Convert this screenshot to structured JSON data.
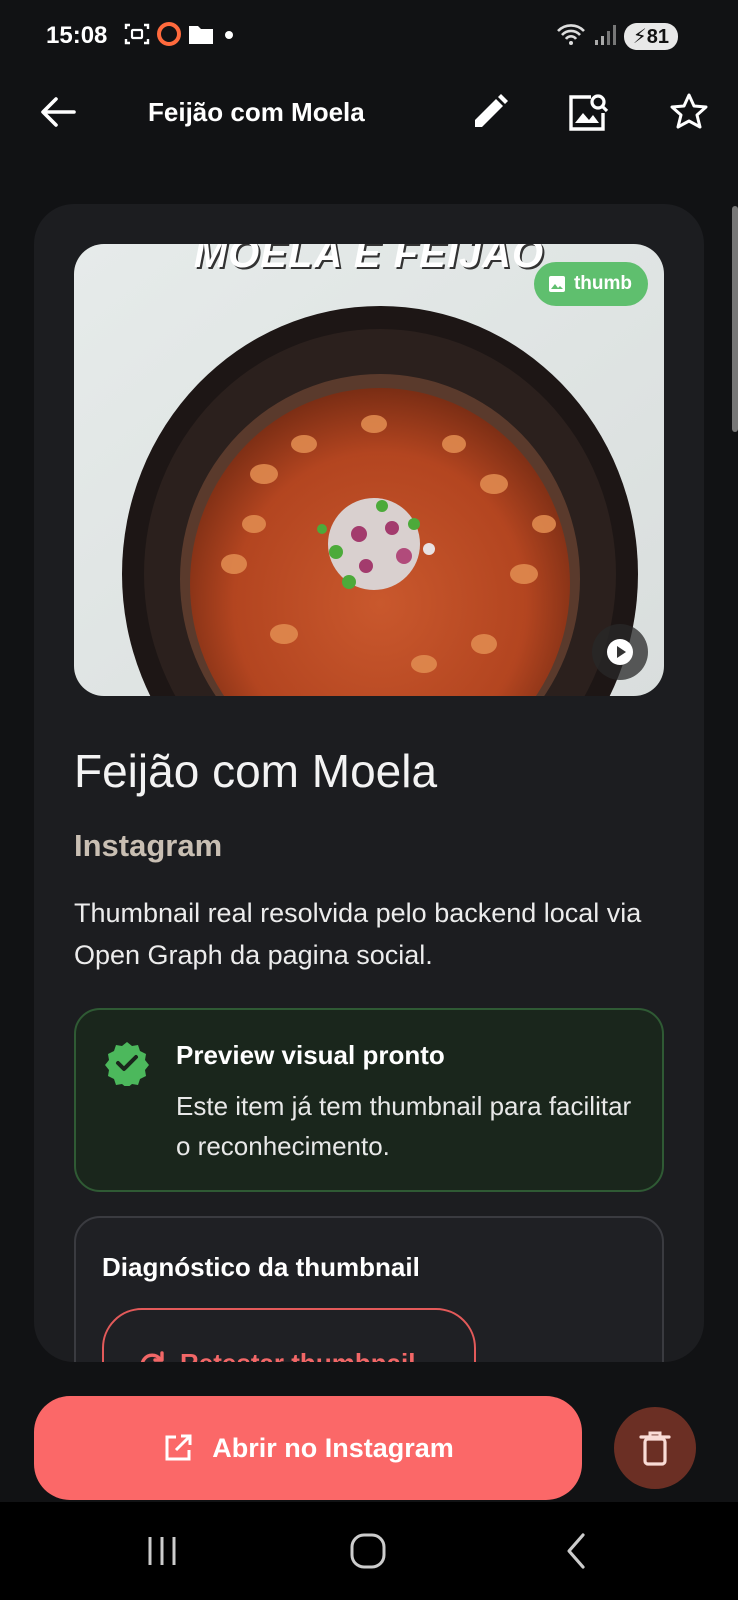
{
  "status_bar": {
    "time": "15:08",
    "battery": "81",
    "icons": [
      "screenshot-icon",
      "record-icon",
      "folder-icon",
      "dot-icon",
      "wifi-icon",
      "signal-icon",
      "battery-icon"
    ]
  },
  "top_bar": {
    "title": "Feijão com Moela",
    "actions": [
      "back-icon",
      "edit-icon",
      "image-search-icon",
      "star-icon"
    ]
  },
  "thumbnail": {
    "overlay_text": "MOELA E FEIJÃO",
    "badge_label": "thumb",
    "badge_color": "#5fbf6e"
  },
  "item": {
    "title": "Feijão com Moela",
    "source": "Instagram",
    "description": "Thumbnail real resolvida pelo backend local via Open Graph da pagina social."
  },
  "preview_status": {
    "title": "Preview visual pronto",
    "text": "Este item já tem thumbnail para facilitar o reconhecimento.",
    "color": "#4cb85c"
  },
  "diagnostics": {
    "title": "Diagnóstico da thumbnail",
    "retest_label": "Retestar thumbnail"
  },
  "bottom_actions": {
    "open_label": "Abrir no Instagram",
    "accent": "#fb6868",
    "delete_color": "#6b2f24"
  }
}
